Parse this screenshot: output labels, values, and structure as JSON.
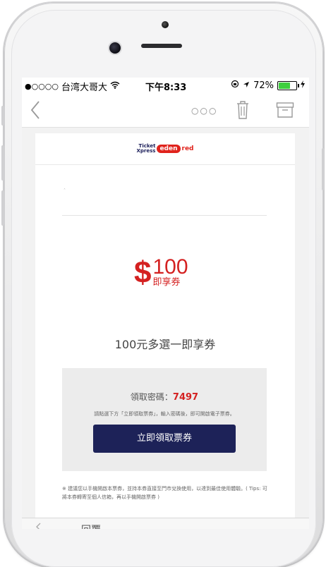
{
  "statusbar": {
    "signal_dots": "●○○○○",
    "carrier": "台湾大哥大",
    "wifi_icon": "wifi-icon",
    "time": "下午8:33",
    "battery_percent": "72%",
    "battery_level": 0.72
  },
  "navbar": {
    "back_icon": "chevron-left-icon",
    "more_label": "○○○",
    "trash_icon": "trash-icon",
    "archive_icon": "archive-icon"
  },
  "email": {
    "logo": {
      "ticket": "Ticket",
      "xpress": "Xpress",
      "eden": "eden",
      "red": "red"
    },
    "amount": {
      "dollar": "$",
      "number": "100",
      "subtitle": "即享券"
    },
    "coupon_title": "100元多選一即享券",
    "code_label": "領取密碼：",
    "code_value": "7497",
    "code_hint": "請點選下方「立即領取票券」，輸入密碼後，即可開啟電子票券。",
    "claim_button": "立即領取票券",
    "footnote": "※ 建議您以手機開啟本票券，並持本券直接至門市兌換使用，以達到最佳使用體驗。( Tips: 可將本券轉寄至個人信箱，再以手機開啟票券 )"
  },
  "bottom": {
    "reply_label": "回覆"
  },
  "colors": {
    "brand_navy": "#1d2258",
    "accent_red": "#d42121",
    "battery_green": "#3ecf3e"
  }
}
